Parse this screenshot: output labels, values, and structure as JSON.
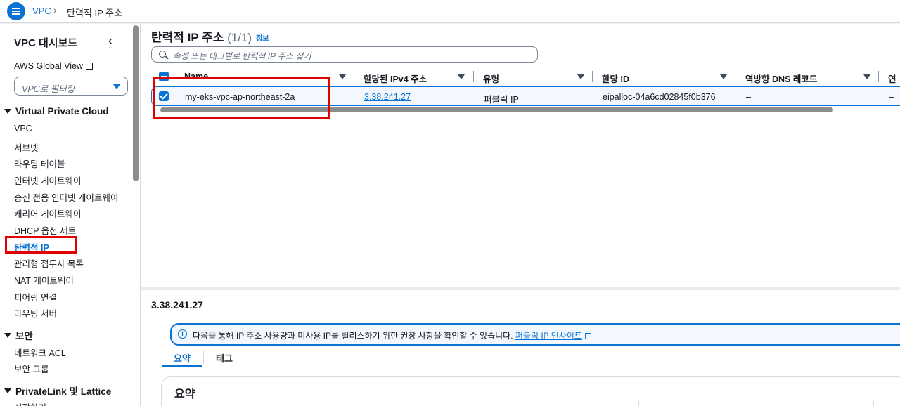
{
  "breadcrumb": {
    "root": "VPC",
    "current": "탄력적 IP 주소"
  },
  "sidebar": {
    "title": "VPC 대시보드",
    "global_view": "AWS Global View",
    "filter_placeholder": "VPC로 필터링",
    "sections": [
      {
        "label": "Virtual Private Cloud",
        "items": [
          "VPC",
          "서브넷",
          "라우팅 테이블",
          "인터넷 게이트웨이",
          "송신 전용 인터넷 게이트웨이",
          "캐리어 게이트웨이",
          "DHCP 옵션 세트",
          "탄력적 IP",
          "관리형 접두사 목록",
          "NAT 게이트웨이",
          "피어링 연결",
          "라우팅 서버"
        ]
      },
      {
        "label": "보안",
        "items": [
          "네트워크 ACL",
          "보안 그룹"
        ]
      },
      {
        "label": "PrivateLink 및 Lattice",
        "items": [
          "시작하기"
        ]
      }
    ],
    "active_item": "탄력적 IP"
  },
  "main": {
    "title": "탄력적 IP 주소",
    "count": "(1/1)",
    "info_link": "정보",
    "search_placeholder": "속성 또는 태그별로 탄력적 IP 주소 찾기",
    "columns": [
      "Name",
      "할당된 IPv4 주소",
      "유형",
      "할당 ID",
      "역방향 DNS 레코드",
      "연결"
    ],
    "rows": [
      {
        "name": "my-eks-vpc-ap-northeast-2a",
        "ipv4": "3.38.241.27",
        "type": "퍼블릭 IP",
        "allocation_id": "eipalloc-04a6cd02845f0b376",
        "reverse_dns": "–",
        "assoc": "–",
        "selected": true
      }
    ]
  },
  "detail": {
    "title": "3.38.241.27",
    "alert_text": "다음을 통해 IP 주소 사용량과 미사용 IP를 릴리스하기 위한 권장 사항을 확인할 수 있습니다.",
    "alert_link": "퍼블릭 IP 인사이트",
    "tabs": [
      "요약",
      "태그"
    ],
    "active_tab": "요약",
    "summary_heading": "요약"
  },
  "colors": {
    "accent": "#0972d3",
    "highlight": "#e00000"
  }
}
